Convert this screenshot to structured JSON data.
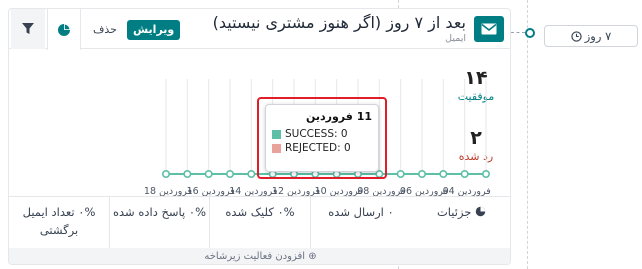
{
  "header": {
    "title": "بعد از ۷ روز (اگر هنوز مشتری نیستید)",
    "subtitle": "ایمیل",
    "edit_label": "ویرایش",
    "delete_label": "حذف"
  },
  "stats": {
    "success_value": "۱۴",
    "success_label": "موفقیت",
    "rejected_value": "۲",
    "rejected_label": "رد شده"
  },
  "tooltip": {
    "title": "11 فروردین",
    "rows": [
      {
        "label": "SUCCESS: 0"
      },
      {
        "label": "REJECTED: 0"
      }
    ]
  },
  "chart_data": {
    "type": "line",
    "x": [
      "18 فروردین",
      "17",
      "16 فروردین",
      "15",
      "14 فروردین",
      "13",
      "12 فروردین",
      "11",
      "10 فروردین",
      "09",
      "08 فروردین",
      "07",
      "06 فروردین",
      "05",
      "04 فروردین",
      "03"
    ],
    "x_tick_labels": [
      "18 فروردین",
      "16 فروردین",
      "14 فروردین",
      "12 فروردین",
      "10 فروردین",
      "08 فروردین",
      "06 فروردین",
      "04 فروردین"
    ],
    "series": [
      {
        "name": "SUCCESS",
        "values": [
          0,
          0,
          0,
          0,
          0,
          0,
          0,
          0,
          0,
          0,
          0,
          0,
          0,
          0,
          0,
          0
        ]
      },
      {
        "name": "REJECTED",
        "values": [
          0,
          0,
          0,
          0,
          0,
          0,
          0,
          0,
          0,
          0,
          0,
          0,
          0,
          0,
          0,
          0
        ]
      }
    ],
    "colors": {
      "success": "#5ebfa8",
      "rejected": "#e8a19b"
    },
    "grid": true
  },
  "metrics": {
    "details": "جزئیات",
    "sent": "۰ ارسال شده",
    "clicked": "۰% کلیک شده",
    "replied": "۰% پاسخ داده شده",
    "bounced": "۰% تعداد ایمیل برگشتی"
  },
  "add_activity": "افزودن فعالیت زیرشاخه",
  "timeline_badge": "۷ روز",
  "colors": {
    "accent": "#017e84",
    "rejected_text": "#c0392b",
    "success_text": "#017e84"
  }
}
